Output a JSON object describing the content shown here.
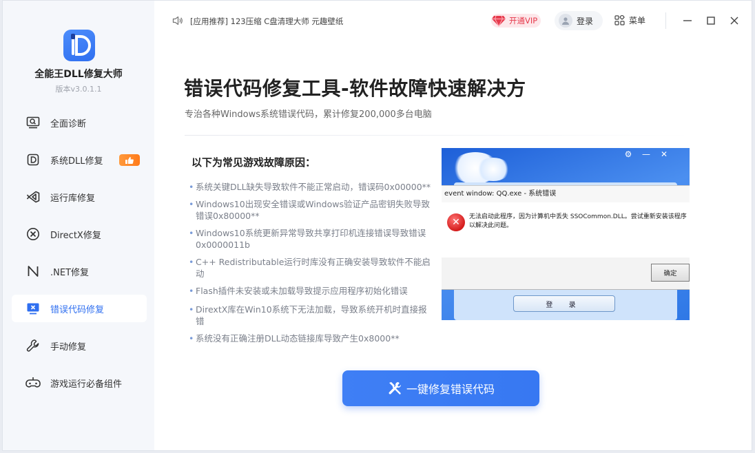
{
  "app": {
    "name": "全能王DLL修复大师",
    "version": "版本v3.0.1.1"
  },
  "sidebar": {
    "items": [
      {
        "label": "全面诊断",
        "icon": "monitor-search-icon",
        "active": false
      },
      {
        "label": "系统DLL修复",
        "icon": "dll-file-icon",
        "active": false,
        "badge": "thumbs-up-icon"
      },
      {
        "label": "运行库修复",
        "icon": "visual-studio-icon",
        "active": false
      },
      {
        "label": "DirectX修复",
        "icon": "directx-icon",
        "active": false
      },
      {
        "label": ".NET修复",
        "icon": "dotnet-icon",
        "active": false
      },
      {
        "label": "错误代码修复",
        "icon": "monitor-error-icon",
        "active": true
      },
      {
        "label": "手动修复",
        "icon": "wrench-icon",
        "active": false
      },
      {
        "label": "游戏运行必备组件",
        "icon": "gamepad-icon",
        "active": false
      }
    ]
  },
  "topbar": {
    "notice": "[应用推荐] 123压缩 C盘清理大师 元趣壁纸",
    "vip_label": "开通VIP",
    "login_label": "登录",
    "menu_label": "菜单"
  },
  "main": {
    "title": "错误代码修复工具-软件故障快速解决方",
    "subtitle": "专治各种Windows系统错误代码，累计修复200,000多台电脑",
    "cause_heading": "以下为常见游戏故障原因：",
    "causes": [
      "系统关键DLL缺失导致软件不能正常启动，错误码0x00000**",
      "Windows10出现安全错误或Windows验证产品密钥失败导致错误0x80000**",
      "Windows10系统更新异常导致共享打印机连接错误导致错误0x0000011b",
      "C++ Redistributable运行时库没有正确安装导致软件不能启动",
      "Flash插件未安装或未加载导致提示应用程序初始化错误",
      "DirextX库在Win10系统下无法加载，导致系统开机时直接报错",
      "系统没有正确注册DLL动态链接库导致产生0x8000**"
    ],
    "bullet": "•",
    "fix_button": "一键修复错误代码"
  },
  "screenshot": {
    "dialog_title": "event window: QQ.exe - 系统错误",
    "error_message": "无法启动此程序，因为计算机中丢失 SSOCommon.DLL。尝试重新安装该程序以解决此问题。",
    "ok_button": "确定",
    "login_button": "登 录",
    "error_glyph": "✕"
  },
  "colors": {
    "accent": "#2f6ff0",
    "sidebar_bg": "#f5f7fb",
    "vip_red": "#e63b4d",
    "badge_orange": "#ff8a2a"
  }
}
